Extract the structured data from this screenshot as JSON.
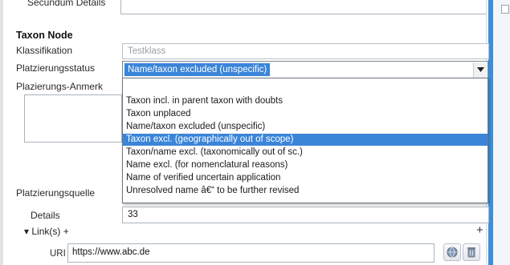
{
  "top_label": "Secundum Details",
  "taxon_node": {
    "title": "Taxon Node",
    "klassifikation_label": "Klassifikation",
    "klassifikation_value": "Testklass",
    "status_label": "Platzierungsstatus",
    "status_selected": "Name/taxon excluded (unspecific)",
    "anmerkung_label": "Plazierungs-Anmerk",
    "dropdown_options": [
      "",
      "Taxon incl. in parent taxon with doubts",
      "Taxon unplaced",
      "Name/taxon excluded (unspecific)",
      "Taxon excl. (geographically out of scope)",
      "Taxon/name excl. (taxonomically out of sc.)",
      "Name excl. (for nomenclatural reasons)",
      "Name of verified uncertain application",
      "Unresolved name â€“ to be further revised"
    ],
    "dropdown_highlighted_index": 4,
    "quelle_label": "Platzierungsquelle",
    "details_label": "Details",
    "details_value": "33",
    "links_label": "▾ Link(s) +",
    "add_label": "+",
    "uri_label": "URI",
    "uri_value": "https://www.abc.de"
  },
  "icons": {
    "dropdown_arrow": "chevron-down-icon",
    "globe": "globe-icon",
    "delete": "trash-icon"
  },
  "colors": {
    "selection": "#3a85d8",
    "frame_blue": "#3b8fd8"
  }
}
